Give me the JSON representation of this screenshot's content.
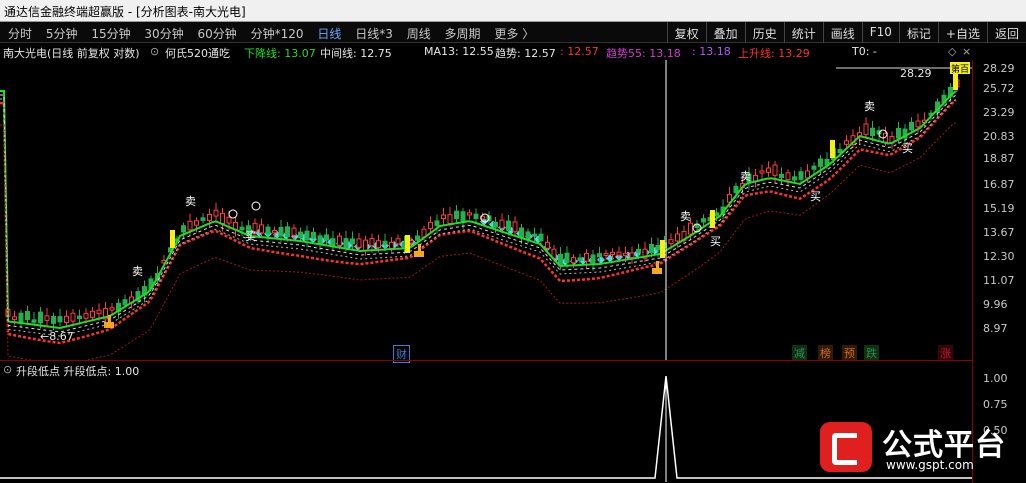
{
  "window": {
    "title": "通达信金融终端超赢版 - [分析图表-南大光电]"
  },
  "toolbar": {
    "periods": [
      "分时",
      "5分钟",
      "15分钟",
      "30分钟",
      "60分钟",
      "分钟*120",
      "日线",
      "日线*3",
      "周线",
      "多周期",
      "更多 〉"
    ],
    "active_period": "日线",
    "right_buttons": [
      "复权",
      "叠加",
      "历史",
      "统计",
      "画线",
      "F10",
      "标记",
      "+自选",
      "返回"
    ]
  },
  "info": {
    "stock_label": "南大光电(日线 前复权 对数)",
    "indicator_name": "何氏520通吃",
    "down_line": "下降线: 13.07",
    "mid_line": "中间线: 12.75",
    "ma13": "MA13: 12.55",
    "trend": "趋势: 12.57",
    "trend_red": ": 12.57",
    "trend55": "趋势55: 13.18",
    "trend55_b": ": 13.18",
    "up_line": "上升线: 13.29",
    "t0": "T0: -"
  },
  "price_axis": [
    "28.29",
    "25.72",
    "23.29",
    "20.83",
    "18.87",
    "16.87",
    "15.19",
    "13.67",
    "12.30",
    "11.07",
    "9.96",
    "8.97"
  ],
  "chart_annotations": {
    "high_label": "28.29",
    "low_label": "←8.67",
    "top_badge": "第百",
    "signal_sell": "卖",
    "signal_buy": "买"
  },
  "events": [
    {
      "text": "财",
      "color": "#3a7bd5"
    },
    {
      "text": "减",
      "color": "#2e8b57"
    },
    {
      "text": "榜",
      "color": "#d2691e"
    },
    {
      "text": "预",
      "color": "#d2691e"
    },
    {
      "text": "跌",
      "color": "#2e8b57"
    },
    {
      "text": "涨",
      "color": "#c8102e"
    }
  ],
  "subpanel": {
    "label": "升段低点  升段低点: 1.00",
    "axis": [
      "1.00",
      "0.75",
      "0.50"
    ]
  },
  "watermark": {
    "text": "公式平台",
    "url": "www.gspt.com"
  },
  "colors": {
    "up": "#ff3c3c",
    "down": "#22b14c",
    "ma_green": "#22dd22",
    "ma_red": "#ff3030",
    "diamond": "#4fd4e8",
    "signal_yellow": "#f4f016"
  }
}
